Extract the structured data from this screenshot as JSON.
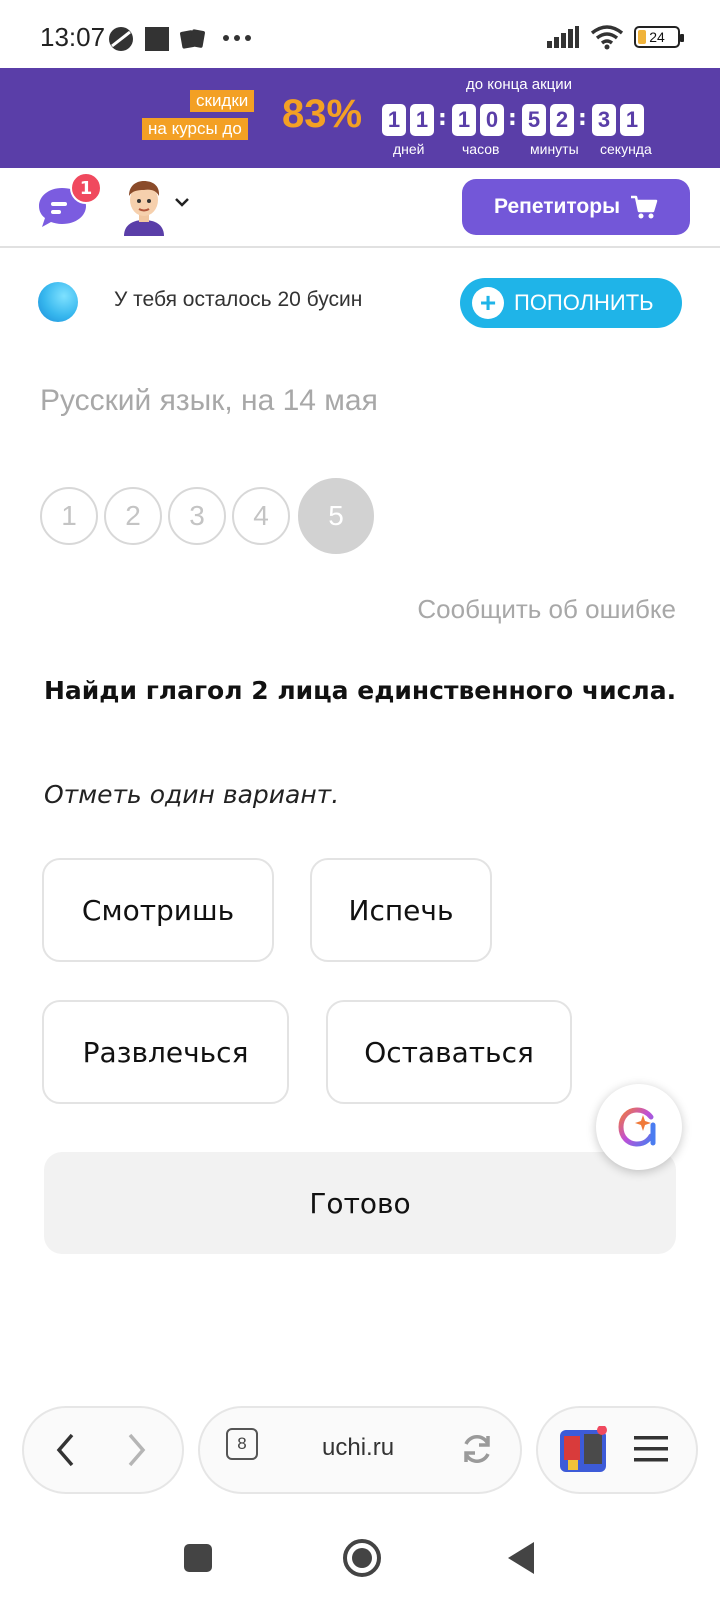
{
  "status_bar": {
    "time": "13:07",
    "battery": "24"
  },
  "promo": {
    "tag_line1": "скидки",
    "tag_line2": "на курсы до",
    "percent": "83%",
    "until_label": "до конца акции",
    "digits": [
      "1",
      "1",
      "1",
      "0",
      "5",
      "2",
      "3",
      "1"
    ],
    "units": [
      "дней",
      "часов",
      "минуты",
      "секунда"
    ]
  },
  "header": {
    "chat_badge": "1",
    "tutors_label": "Репетиторы"
  },
  "beads": {
    "text": "У тебя осталось 20 бусин",
    "topup_label": "ПОПОЛНИТЬ"
  },
  "lesson": {
    "subject": "Русский язык, на 14 мая",
    "steps": [
      "1",
      "2",
      "3",
      "4",
      "5"
    ],
    "report": "Сообщить об ошибке",
    "question": "Найди глагол 2 лица единственного числа.",
    "hint": "Отметь один вариант.",
    "options": [
      "Смотришь",
      "Испечь",
      "Развлечься",
      "Оставаться"
    ],
    "done_label": "Готово"
  },
  "browser": {
    "tabs_count": "8",
    "url": "uchi.ru"
  },
  "colors": {
    "promo_bg": "#5a3ea8",
    "accent_orange": "#f3a024",
    "tutors_btn": "#7357d8",
    "topup_btn": "#1fb4e8",
    "badge_red": "#f0495e"
  }
}
